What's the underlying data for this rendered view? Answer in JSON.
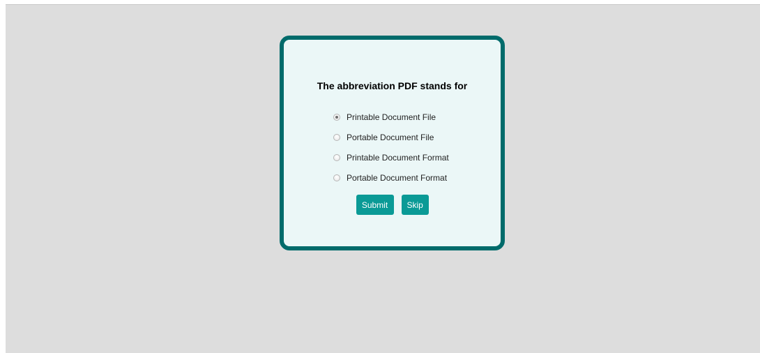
{
  "quiz": {
    "question": "The abbreviation PDF stands for",
    "options": [
      {
        "label": "Printable Document File",
        "selected": true
      },
      {
        "label": "Portable Document File",
        "selected": false
      },
      {
        "label": "Printable Document Format",
        "selected": false
      },
      {
        "label": "Portable Document Format",
        "selected": false
      }
    ],
    "submit_label": "Submit",
    "skip_label": "Skip"
  },
  "colors": {
    "page_background": "#dddddd",
    "card_border": "#006b6b",
    "card_background": "#ebf7f7",
    "button_background": "#0a9a96"
  }
}
